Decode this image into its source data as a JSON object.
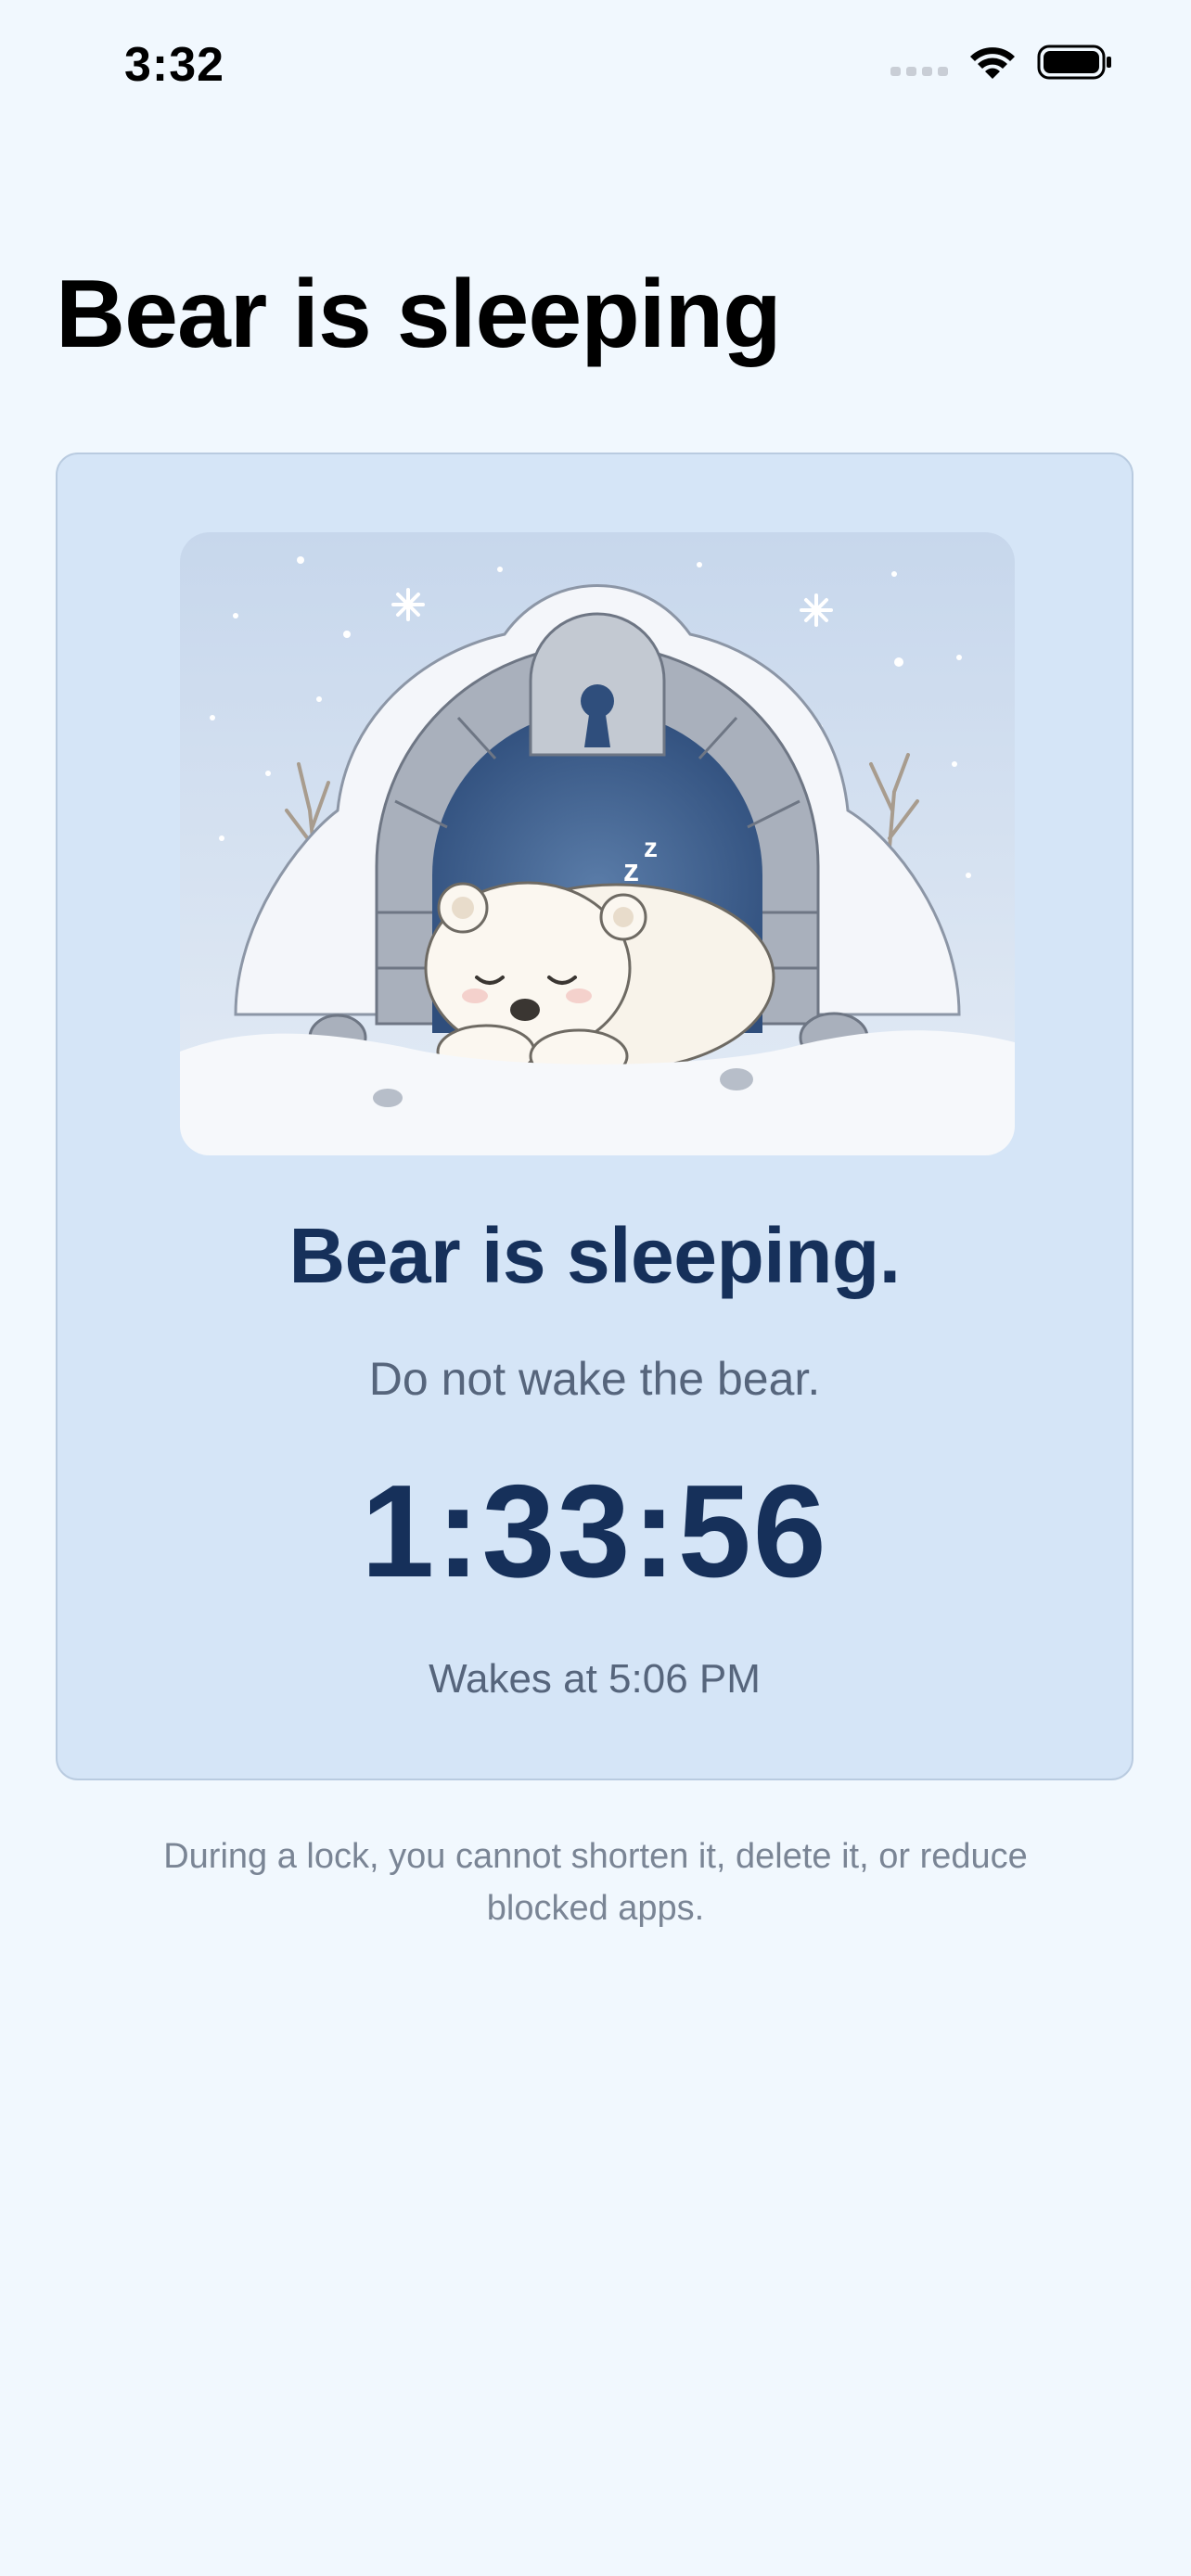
{
  "status_bar": {
    "time": "3:32"
  },
  "page": {
    "title": "Bear is sleeping"
  },
  "card": {
    "illustration_icon": "sleeping-bear-in-snow-den-illustration",
    "headline": "Bear is sleeping.",
    "subtitle": "Do not wake the bear.",
    "countdown": "1:33:56",
    "wake_text": "Wakes at 5:06 PM"
  },
  "footnote": "During a lock, you cannot shorten it, delete it, or reduce blocked apps.",
  "colors": {
    "background": "#F1F8FE",
    "card_background": "#D5E5F7",
    "accent_text": "#16305A",
    "secondary_text": "#56657C"
  }
}
